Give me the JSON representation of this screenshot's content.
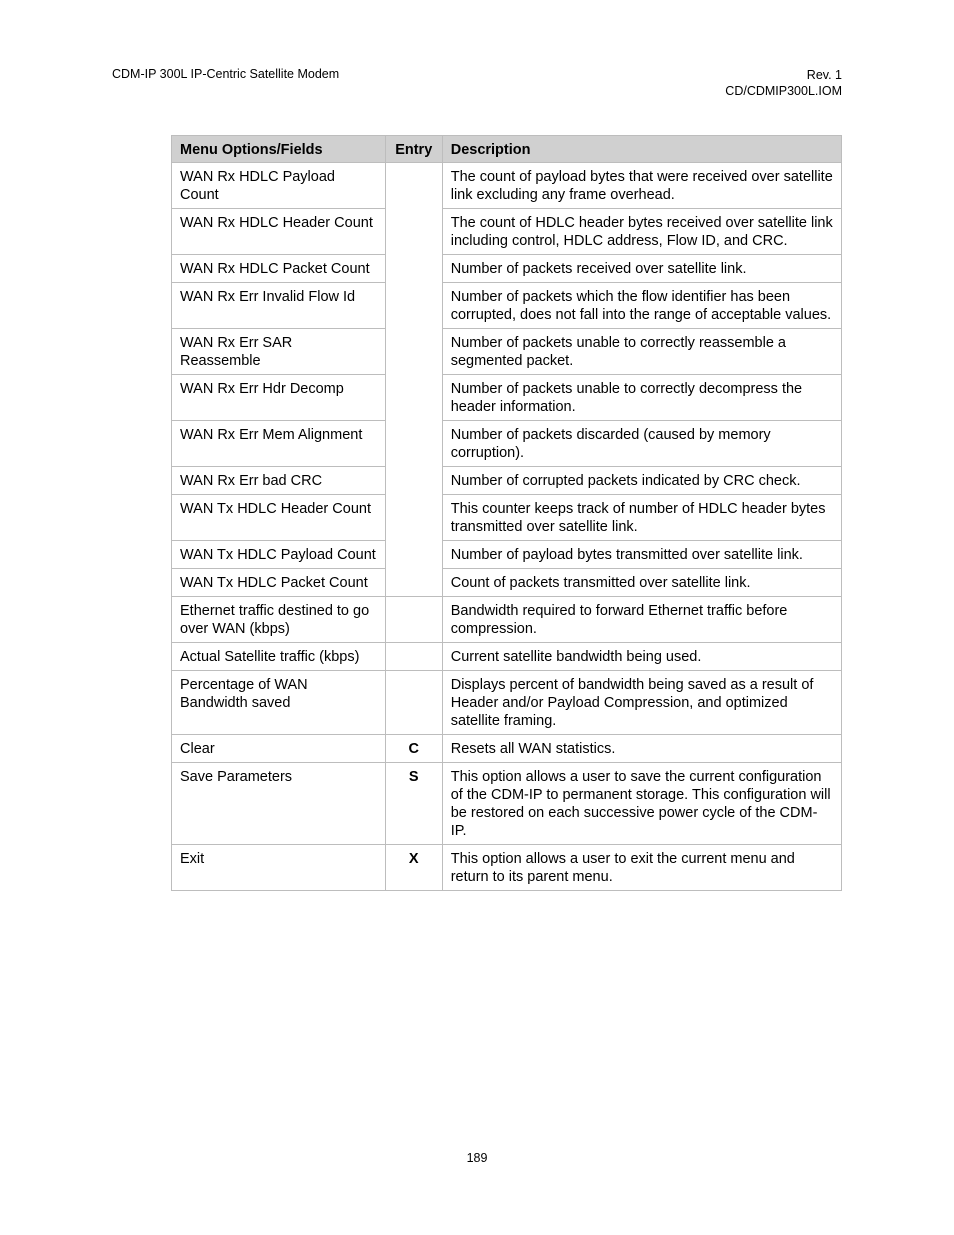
{
  "header": {
    "left": "CDM-IP 300L IP-Centric Satellite Modem",
    "right_line1": "Rev. 1",
    "right_line2": "CD/CDMIP300L.IOM"
  },
  "table": {
    "columns": [
      "Menu Options/Fields",
      "Entry",
      "Description"
    ],
    "rows": [
      {
        "field": "WAN Rx HDLC Payload Count",
        "entry": "",
        "description": "The count of payload bytes that were received over satellite link excluding any frame overhead."
      },
      {
        "field": "WAN Rx HDLC Header Count",
        "entry": "",
        "description": "The count of HDLC header bytes received over satellite link including control, HDLC address, Flow ID, and CRC."
      },
      {
        "field": "WAN Rx HDLC Packet Count",
        "entry": "",
        "description": "Number of packets received over satellite link."
      },
      {
        "field": "WAN Rx Err Invalid Flow Id",
        "entry": "",
        "description": "Number of packets which the flow identifier has been corrupted, does not fall into the range of acceptable values."
      },
      {
        "field": "WAN Rx Err SAR Reassemble",
        "entry": "",
        "description": "Number of packets unable to correctly reassemble a segmented packet."
      },
      {
        "field": "WAN Rx Err Hdr Decomp",
        "entry": "",
        "description": "Number of packets unable to correctly decompress the header information."
      },
      {
        "field": "WAN Rx Err Mem Alignment",
        "entry": "",
        "description": "Number of packets discarded (caused by memory corruption)."
      },
      {
        "field": "WAN Rx Err bad CRC",
        "entry": "",
        "description": "Number of corrupted packets indicated by CRC check."
      },
      {
        "field": "WAN Tx HDLC Header Count",
        "entry": "",
        "description": "This counter keeps track of number of HDLC header bytes transmitted over satellite link."
      },
      {
        "field": "WAN Tx  HDLC Payload Count",
        "entry": "",
        "description": "Number of payload bytes transmitted over satellite link."
      },
      {
        "field": "WAN Tx HDLC Packet Count",
        "entry": "",
        "description": "Count of packets transmitted over satellite link."
      },
      {
        "field": "Ethernet traffic destined to go over WAN (kbps)",
        "entry": "",
        "description": "Bandwidth required to forward Ethernet traffic before compression."
      },
      {
        "field": "Actual Satellite traffic (kbps)",
        "entry": "",
        "description": "Current satellite bandwidth being used."
      },
      {
        "field": "Percentage of WAN Bandwidth saved",
        "entry": "",
        "description": "Displays percent of bandwidth being saved as a result of Header and/or Payload Compression, and optimized satellite framing."
      },
      {
        "field": "Clear",
        "entry": "C",
        "description": "Resets all WAN statistics."
      },
      {
        "field": "Save Parameters",
        "entry": "S",
        "description": "This option allows a user to save the current configuration of the CDM-IP to permanent storage. This configuration will be restored on each successive power cycle of the CDM-IP."
      },
      {
        "field": "Exit",
        "entry": "X",
        "description": "This option allows a user to exit the current menu and return to its parent menu."
      }
    ]
  },
  "footer": {
    "page_number": "189"
  }
}
